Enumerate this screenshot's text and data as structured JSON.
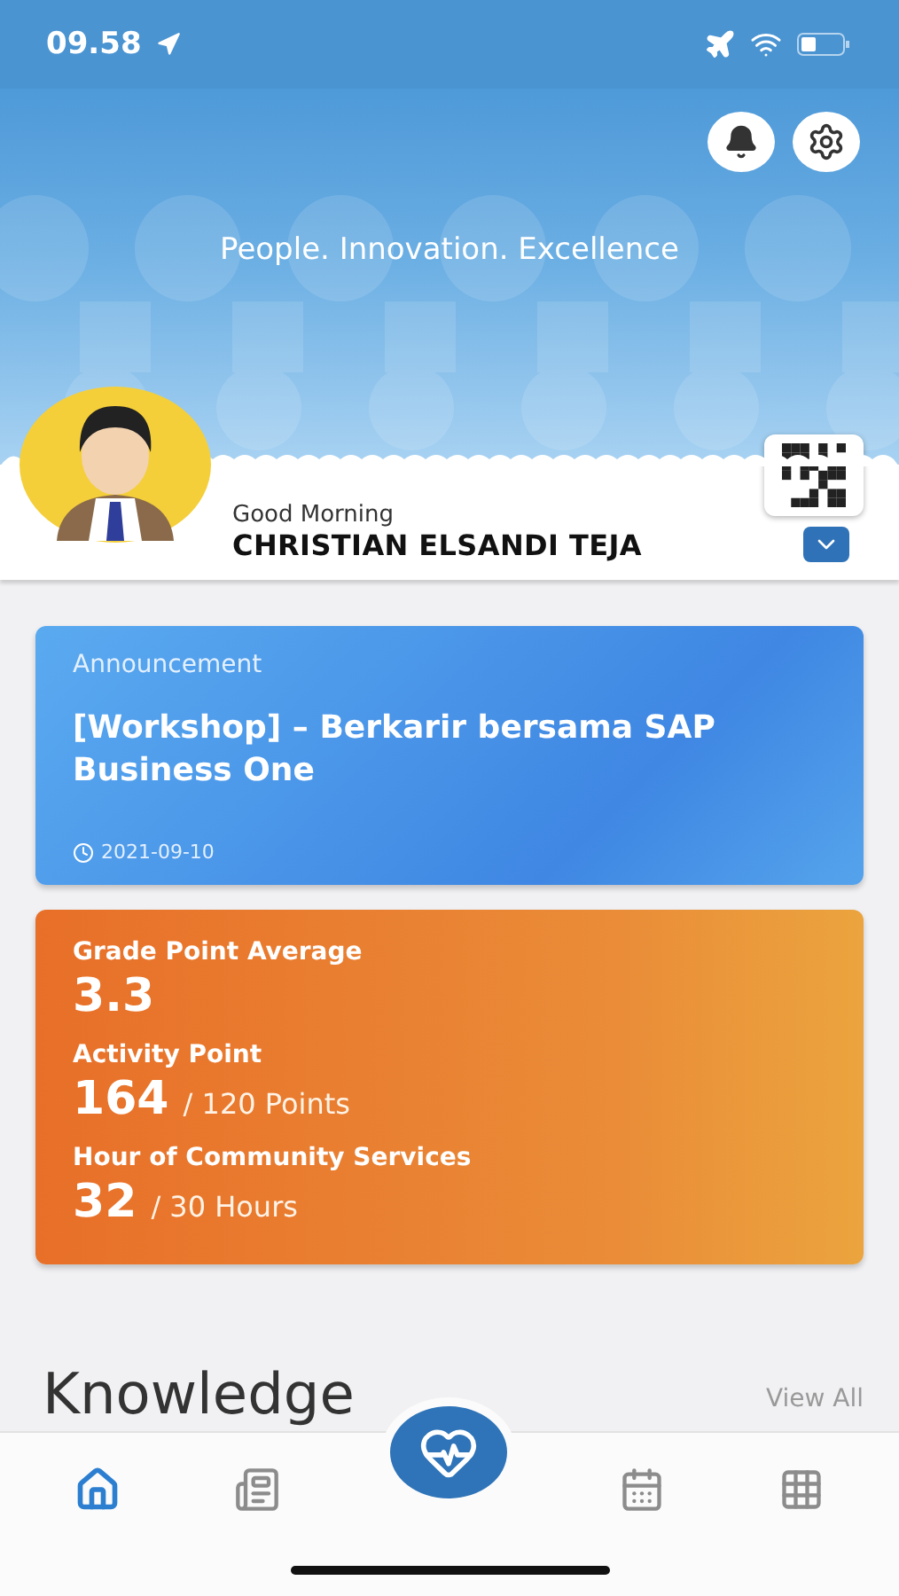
{
  "status_bar": {
    "time": "09.58"
  },
  "header": {
    "tagline": "People. Innovation. Excellence"
  },
  "profile": {
    "greeting": "Good Morning",
    "name": "CHRISTIAN ELSANDI TEJA"
  },
  "announcement": {
    "label": "Announcement",
    "title": "[Workshop] – Berkarir bersama SAP Business One",
    "date": "2021-09-10"
  },
  "stats": [
    {
      "label": "Grade Point Average",
      "value": "3.3"
    },
    {
      "label": "Activity Point",
      "value": "164",
      "target": "/ 120 Points"
    },
    {
      "label": "Hour of Community Services",
      "value": "32",
      "target": "/ 30 Hours"
    }
  ],
  "section": {
    "title": "Knowledge",
    "link": "View All"
  },
  "nav": [
    {
      "kind": "home",
      "selected": true
    },
    {
      "kind": "news",
      "selected": false
    },
    {
      "kind": "health",
      "selected": false
    },
    {
      "kind": "calendar",
      "selected": false
    },
    {
      "kind": "apps",
      "selected": false
    }
  ]
}
